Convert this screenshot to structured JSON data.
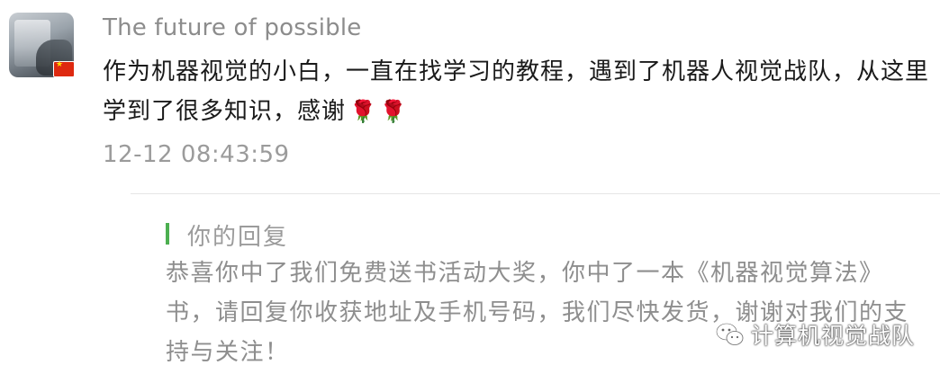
{
  "comment": {
    "username": "The future of possible",
    "avatar_icon": "user-avatar-photo",
    "flag_icon": "china-flag-icon",
    "text": "作为机器视觉的小白，一直在找学习的教程，遇到了机器人视觉战队，从这里学到了很多知识，感谢",
    "emoji": "🌹🌹",
    "emoji_icon": "rose-emoji",
    "timestamp": "12-12 08:43:59"
  },
  "reply": {
    "label": "你的回复",
    "text": "恭喜你中了我们免费送书活动大奖，你中了一本《机器视觉算法》书，请回复你收获地址及手机号码，我们尽快发货，谢谢对我们的支持与关注！",
    "accent_color": "#4caf50"
  },
  "watermark": {
    "icon": "wechat-icon",
    "text": "计算机视觉战队"
  }
}
